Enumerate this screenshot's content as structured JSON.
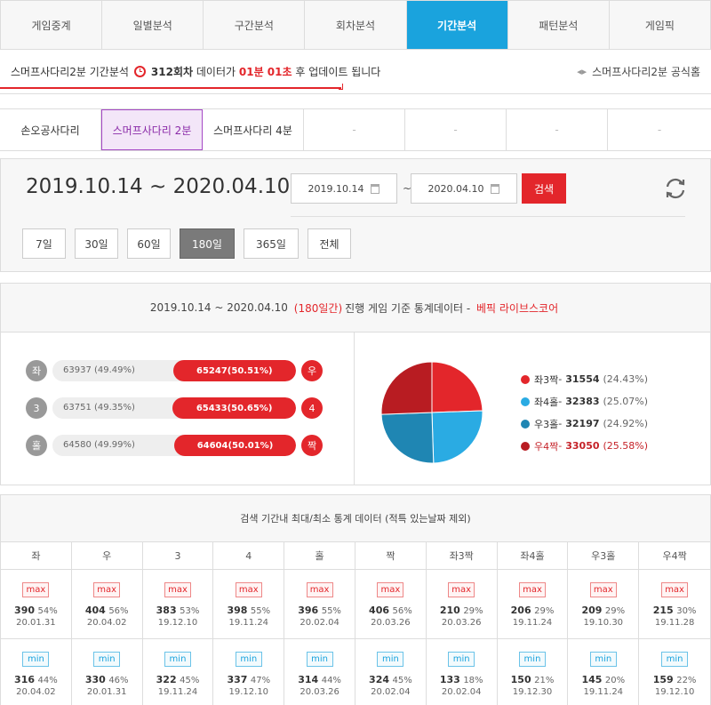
{
  "nav": {
    "tabs": [
      "게임중계",
      "일별분석",
      "구간분석",
      "회차분석",
      "기간분석",
      "패턴분석",
      "게임픽"
    ],
    "active": 4
  },
  "info": {
    "game_name": "스머프사다리2분",
    "analysis_label": "기간분석",
    "round": "312회차",
    "data_text": "데이터가",
    "countdown": "01분 01초",
    "after_text": "후 업데이트 됩니다",
    "home_link": "스머프사다리2분 공식홈"
  },
  "subtabs": [
    {
      "label": "손오공사다리"
    },
    {
      "label": "스머프사다리 2분"
    },
    {
      "label": "스머프사다리 4분"
    },
    {
      "label": "-"
    },
    {
      "label": "-"
    },
    {
      "label": "-"
    },
    {
      "label": "-"
    }
  ],
  "period": {
    "range_text": "2019.10.14 ~ 2020.04.10",
    "start_date": "2019.10.14",
    "end_date": "2020.04.10",
    "tilde": "~",
    "search_label": "검색",
    "day_buttons": [
      "7일",
      "30일",
      "60일",
      "180일",
      "365일",
      "전체"
    ],
    "active_day": 3
  },
  "stats": {
    "range": "2019.10.14 ~ 2020.04.10",
    "days": "(180일간)",
    "desc": "진행 게임 기준 통계데이터 -",
    "source": "베픽 라이브스코어",
    "rows": [
      {
        "left_label": "좌",
        "left_value": "63937",
        "left_pct": "(49.49%)",
        "right_value": "65247",
        "right_pct": "(50.51%)",
        "right_label": "우",
        "right_share": 50.51
      },
      {
        "left_label": "3",
        "left_value": "63751",
        "left_pct": "(49.35%)",
        "right_value": "65433",
        "right_pct": "(50.65%)",
        "right_label": "4",
        "right_share": 50.65
      },
      {
        "left_label": "홀",
        "left_value": "64580",
        "left_pct": "(49.99%)",
        "right_value": "64604",
        "right_pct": "(50.01%)",
        "right_label": "짝",
        "right_share": 50.01
      }
    ],
    "pie": [
      {
        "label": "좌3짝",
        "value": "31554",
        "pct": "(24.43%)",
        "share": 24.43,
        "color": "#e3262b"
      },
      {
        "label": "좌4홀",
        "value": "32383",
        "pct": "(25.07%)",
        "share": 25.07,
        "color": "#2aabe3"
      },
      {
        "label": "우3홀",
        "value": "32197",
        "pct": "(24.92%)",
        "share": 24.92,
        "color": "#1f86b3"
      },
      {
        "label": "우4짝",
        "value": "33050",
        "pct": "(25.58%)",
        "share": 25.58,
        "color": "#b81c22"
      }
    ]
  },
  "minmax": {
    "title": "검색 기간내 최대/최소 통계 데이터 (적특 있는날짜 제외)",
    "max_label": "max",
    "min_label": "min",
    "columns": [
      "좌",
      "우",
      "3",
      "4",
      "홀",
      "짝",
      "좌3짝",
      "좌4홀",
      "우3홀",
      "우4짝"
    ],
    "max": [
      {
        "v": "390",
        "p": "54%",
        "d": "20.01.31"
      },
      {
        "v": "404",
        "p": "56%",
        "d": "20.04.02"
      },
      {
        "v": "383",
        "p": "53%",
        "d": "19.12.10"
      },
      {
        "v": "398",
        "p": "55%",
        "d": "19.11.24"
      },
      {
        "v": "396",
        "p": "55%",
        "d": "20.02.04"
      },
      {
        "v": "406",
        "p": "56%",
        "d": "20.03.26"
      },
      {
        "v": "210",
        "p": "29%",
        "d": "20.03.26"
      },
      {
        "v": "206",
        "p": "29%",
        "d": "19.11.24"
      },
      {
        "v": "209",
        "p": "29%",
        "d": "19.10.30"
      },
      {
        "v": "215",
        "p": "30%",
        "d": "19.11.28"
      }
    ],
    "min": [
      {
        "v": "316",
        "p": "44%",
        "d": "20.04.02"
      },
      {
        "v": "330",
        "p": "46%",
        "d": "20.01.31"
      },
      {
        "v": "322",
        "p": "45%",
        "d": "19.11.24"
      },
      {
        "v": "337",
        "p": "47%",
        "d": "19.12.10"
      },
      {
        "v": "314",
        "p": "44%",
        "d": "20.03.26"
      },
      {
        "v": "324",
        "p": "45%",
        "d": "20.02.04"
      },
      {
        "v": "133",
        "p": "18%",
        "d": "20.02.04"
      },
      {
        "v": "150",
        "p": "21%",
        "d": "19.12.30"
      },
      {
        "v": "145",
        "p": "20%",
        "d": "19.11.24"
      },
      {
        "v": "159",
        "p": "22%",
        "d": "19.12.10"
      }
    ]
  }
}
